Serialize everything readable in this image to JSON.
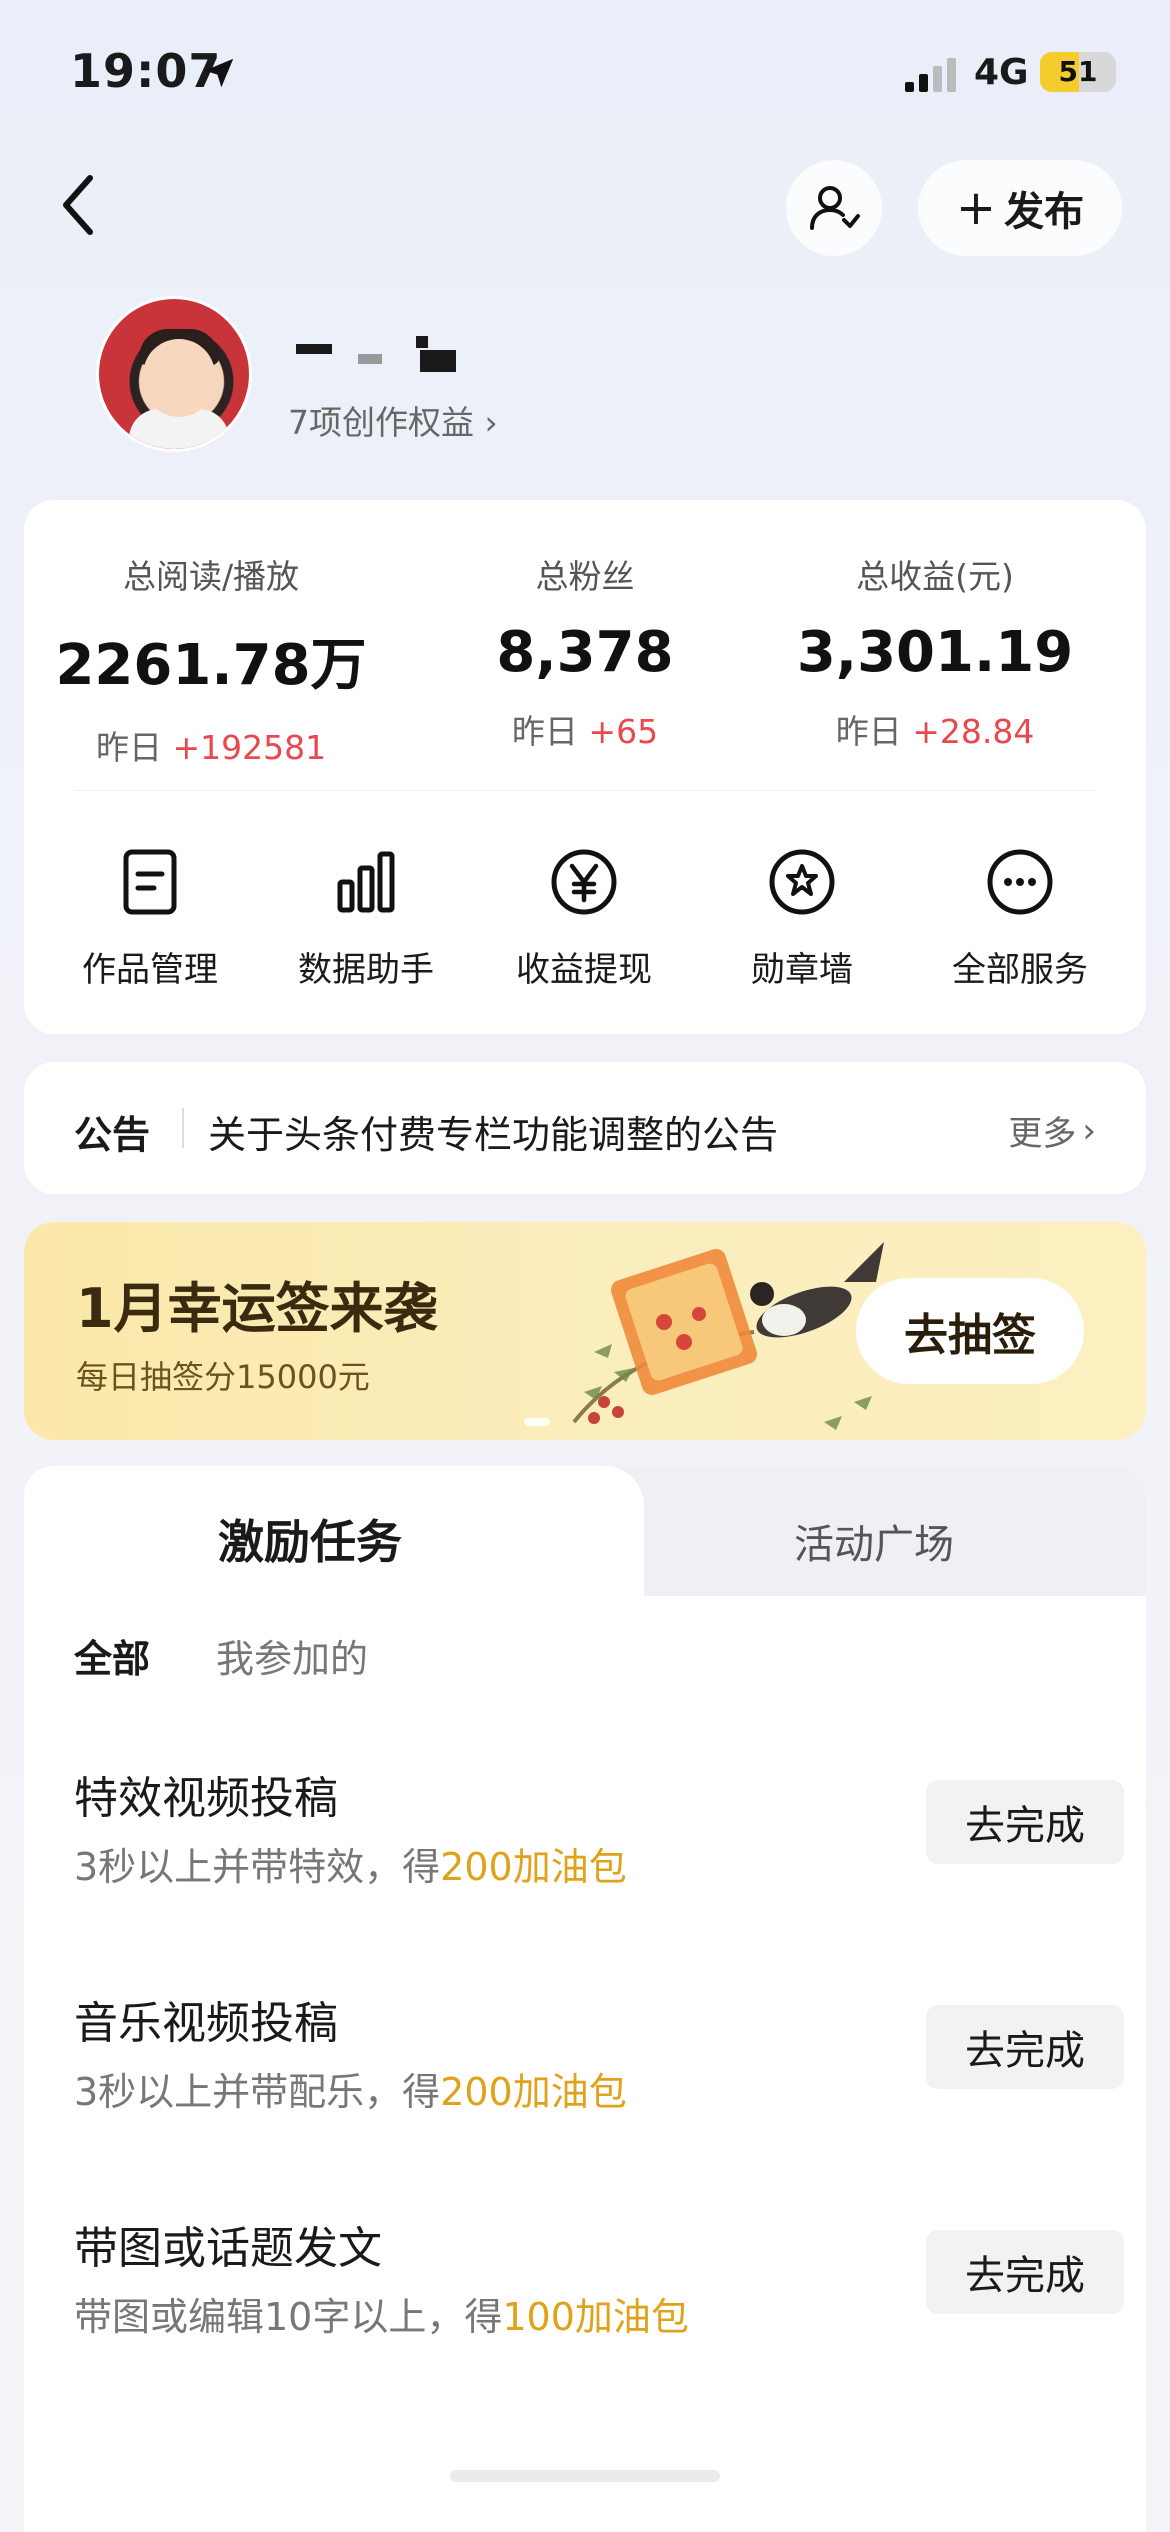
{
  "status_bar": {
    "time": "19:07",
    "network": "4G",
    "battery": "51",
    "battery_level": 0.51,
    "location_icon": "location-arrow-icon",
    "signal_icon": "cellular-signal-icon"
  },
  "nav": {
    "back_icon": "chevron-left-icon",
    "follow_icon": "user-follow-icon",
    "publish_label": "发布"
  },
  "profile": {
    "benefits_label": "7项创作权益"
  },
  "stats": [
    {
      "label": "总阅读/播放",
      "value": "2261.78万",
      "delta_prefix": "昨日",
      "delta": "+192581"
    },
    {
      "label": "总粉丝",
      "value": "8,378",
      "delta_prefix": "昨日",
      "delta": "+65"
    },
    {
      "label": "总收益(元)",
      "value": "3,301.19",
      "delta_prefix": "昨日",
      "delta": "+28.84"
    }
  ],
  "services": [
    {
      "label": "作品管理",
      "icon": "document-icon"
    },
    {
      "label": "数据助手",
      "icon": "bar-chart-icon"
    },
    {
      "label": "收益提现",
      "icon": "yen-icon"
    },
    {
      "label": "勋章墙",
      "icon": "badge-icon"
    },
    {
      "label": "全部服务",
      "icon": "more-icon"
    }
  ],
  "notice": {
    "tag": "公告",
    "text": "关于头条付费专栏功能调整的公告",
    "more": "更多"
  },
  "banner": {
    "title": "1月幸运签来袭",
    "subtitle": "每日抽签分15000元",
    "button": "去抽签"
  },
  "tasks": {
    "tabs": [
      "激励任务",
      "活动广场"
    ],
    "filters": [
      "全部",
      "我参加的"
    ],
    "items": [
      {
        "title": "特效视频投稿",
        "desc_prefix": "3秒以上并带特效，得",
        "reward": "200加油包",
        "button": "去完成"
      },
      {
        "title": "音乐视频投稿",
        "desc_prefix": "3秒以上并带配乐，得",
        "reward": "200加油包",
        "button": "去完成"
      },
      {
        "title": "带图或话题发文",
        "desc_prefix": "带图或编辑10字以上，得",
        "reward": "100加油包",
        "button": "去完成"
      }
    ]
  },
  "colors": {
    "accent_red": "#e8484e",
    "reward_gold": "#e0a21a",
    "banner_yellow": "#fbe8a9",
    "battery_yellow": "#f4cc2b"
  }
}
